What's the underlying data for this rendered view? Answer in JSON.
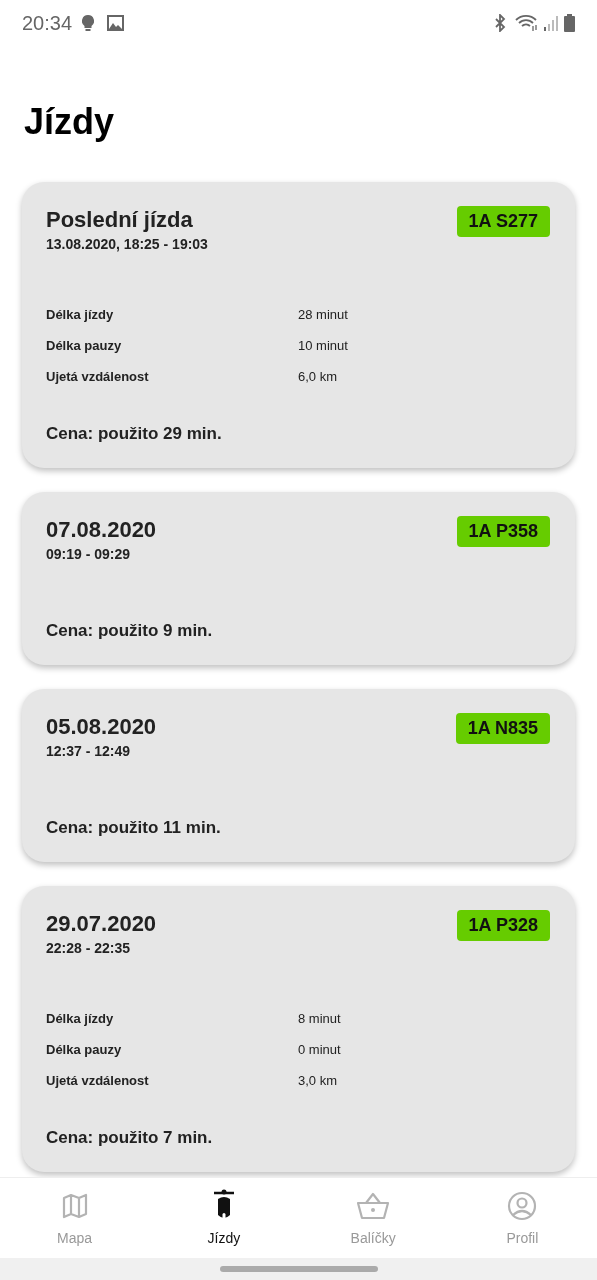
{
  "status_bar": {
    "time": "20:34"
  },
  "title": "Jízdy",
  "rides": [
    {
      "title": "Poslední jízda",
      "subtitle": "13.08.2020, 18:25 - 19:03",
      "plate": "1A S277",
      "details": [
        {
          "label": "Délka jízdy",
          "value": "28 minut"
        },
        {
          "label": "Délka pauzy",
          "value": "10 minut"
        },
        {
          "label": "Ujetá vzdálenost",
          "value": "6,0 km"
        }
      ],
      "price": "Cena: použito 29 min."
    },
    {
      "title": "07.08.2020",
      "subtitle": "09:19 - 09:29",
      "plate": "1A P358",
      "price": "Cena: použito 9 min."
    },
    {
      "title": "05.08.2020",
      "subtitle": "12:37 - 12:49",
      "plate": "1A N835",
      "price": "Cena: použito 11 min."
    },
    {
      "title": "29.07.2020",
      "subtitle": "22:28 - 22:35",
      "plate": "1A P328",
      "details": [
        {
          "label": "Délka jízdy",
          "value": "8 minut"
        },
        {
          "label": "Délka pauzy",
          "value": "0 minut"
        },
        {
          "label": "Ujetá vzdálenost",
          "value": "3,0 km"
        }
      ],
      "price": "Cena: použito 7 min."
    }
  ],
  "tabs": [
    {
      "kind": "map",
      "label": "Mapa",
      "selected": false
    },
    {
      "kind": "scooter",
      "label": "Jízdy",
      "selected": true
    },
    {
      "kind": "basket",
      "label": "Balíčky",
      "selected": false
    },
    {
      "kind": "profile",
      "label": "Profil",
      "selected": false
    }
  ]
}
